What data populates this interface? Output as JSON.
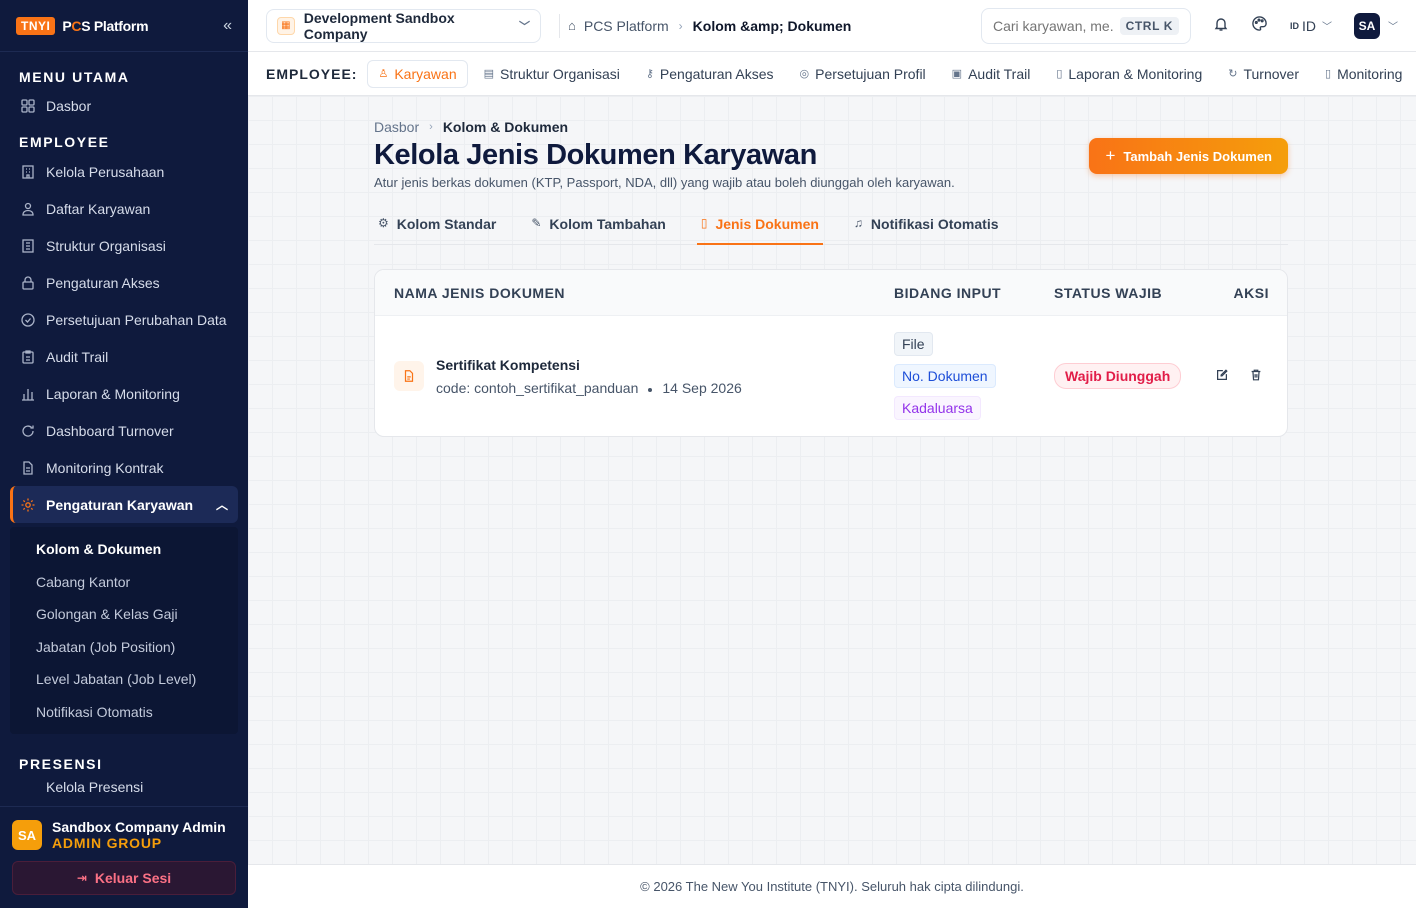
{
  "brand": {
    "badge": "TNYI",
    "name_prefix": "P",
    "name_accent": "C",
    "name_suffix": "S Platform"
  },
  "sidebar": {
    "sections": [
      {
        "title": "MENU UTAMA",
        "items": [
          {
            "label": "Dasbor",
            "icon": "grid-icon"
          }
        ]
      },
      {
        "title": "EMPLOYEE",
        "items": [
          {
            "label": "Kelola Perusahaan",
            "icon": "building-icon"
          },
          {
            "label": "Daftar Karyawan",
            "icon": "users-icon"
          },
          {
            "label": "Struktur Organisasi",
            "icon": "org-icon"
          },
          {
            "label": "Pengaturan Akses",
            "icon": "lock-icon"
          },
          {
            "label": "Persetujuan Perubahan Data",
            "icon": "check-circle-icon"
          },
          {
            "label": "Audit Trail",
            "icon": "clipboard-icon"
          },
          {
            "label": "Laporan & Monitoring",
            "icon": "bar-chart-icon"
          },
          {
            "label": "Dashboard Turnover",
            "icon": "refresh-icon"
          },
          {
            "label": "Monitoring Kontrak",
            "icon": "file-icon"
          }
        ]
      }
    ],
    "active_group": {
      "label": "Pengaturan Karyawan",
      "items": [
        "Kolom & Dokumen",
        "Cabang Kantor",
        "Golongan & Kelas Gaji",
        "Jabatan (Job Position)",
        "Level Jabatan (Job Level)",
        "Notifikasi Otomatis"
      ]
    },
    "presensi": {
      "title": "PRESENSI",
      "first_item": "Kelola Presensi"
    },
    "user": {
      "initials": "SA",
      "name": "Sandbox Company Admin",
      "role": "ADMIN GROUP"
    },
    "logout_label": "Keluar Sesi"
  },
  "topbar": {
    "company": "Development Sandbox Company",
    "breadcrumb": [
      "PCS Platform",
      "Kolom &amp; Dokumen"
    ],
    "search_placeholder": "Cari karyawan, me...",
    "search_shortcut": "CTRL K",
    "lang_flag": "ID",
    "lang": "ID",
    "avatar": "SA"
  },
  "modnav": {
    "label": "EMPLOYEE:",
    "items": [
      "Karyawan",
      "Struktur Organisasi",
      "Pengaturan Akses",
      "Persetujuan Profil",
      "Audit Trail",
      "Laporan & Monitoring",
      "Turnover",
      "Monitoring"
    ]
  },
  "page": {
    "breadcrumb": [
      "Dasbor",
      "Kolom & Dokumen"
    ],
    "title": "Kelola Jenis Dokumen Karyawan",
    "description": "Atur jenis berkas dokumen (KTP, Passport, NDA, dll) yang wajib atau boleh diunggah oleh karyawan.",
    "add_button": "Tambah Jenis Dokumen",
    "tabs": [
      "Kolom Standar",
      "Kolom Tambahan",
      "Jenis Dokumen",
      "Notifikasi Otomatis"
    ],
    "table": {
      "headers": [
        "NAMA JENIS DOKUMEN",
        "BIDANG INPUT",
        "STATUS WAJIB",
        "AKSI"
      ],
      "rows": [
        {
          "name": "Sertifikat Kompetensi",
          "code": "code: contoh_sertifikat_panduan",
          "date": "14 Sep 2026",
          "fields": [
            "File",
            "No. Dokumen",
            "Kadaluarsa"
          ],
          "status": "Wajib Diunggah"
        }
      ]
    }
  },
  "footer": "© 2026 The New You Institute (TNYI). Seluruh hak cipta dilindungi.",
  "colors": {
    "accent": "#f97316",
    "sidebar_bg": "#0f1a3d",
    "danger": "#e11d48"
  }
}
